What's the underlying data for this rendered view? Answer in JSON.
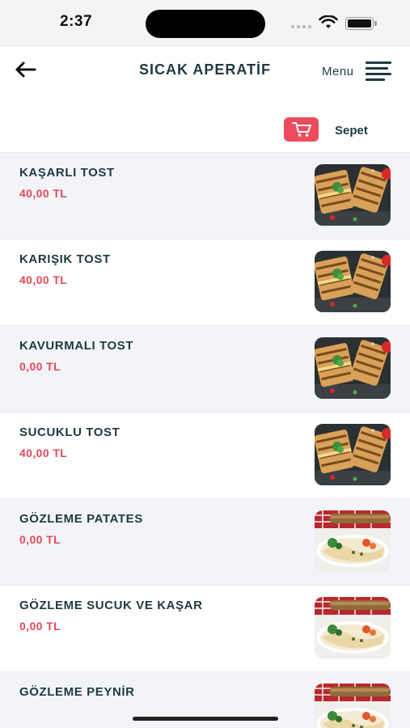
{
  "status_bar": {
    "time": "2:37"
  },
  "header": {
    "title": "SICAK APERATİF",
    "back_icon": "arrow-left-icon",
    "menu_label": "Menu",
    "menu_icon": "hamburger-menu-icon"
  },
  "cart": {
    "icon": "shopping-cart-icon",
    "label": "Sepet",
    "accent_color": "#ec4a5d"
  },
  "products": [
    {
      "name": "KAŞARLI TOST",
      "price": "40,00 TL",
      "image": "toast"
    },
    {
      "name": "KARIŞIK TOST",
      "price": "40,00 TL",
      "image": "toast"
    },
    {
      "name": "KAVURMALI TOST",
      "price": "0,00 TL",
      "image": "toast"
    },
    {
      "name": "SUCUKLU TOST",
      "price": "40,00 TL",
      "image": "toast"
    },
    {
      "name": "GÖZLEME PATATES",
      "price": "0,00 TL",
      "image": "gozleme"
    },
    {
      "name": "GÖZLEME SUCUK VE KAŞAR",
      "price": "0,00 TL",
      "image": "gozleme"
    },
    {
      "name": "GÖZLEME PEYNİR",
      "price": "",
      "image": "gozleme"
    }
  ],
  "colors": {
    "title": "#1f3a40",
    "price": "#e24a5a",
    "row_alt": "#f3f4f8"
  }
}
